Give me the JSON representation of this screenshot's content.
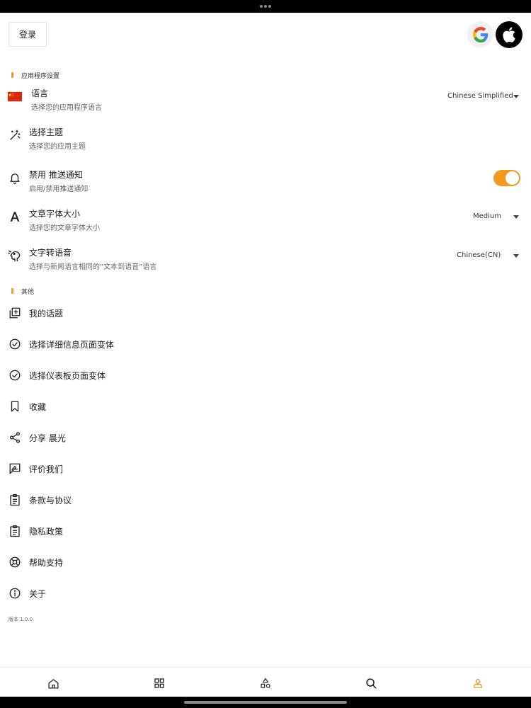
{
  "header": {
    "login_label": "登录"
  },
  "sections": {
    "app_settings": "应用程序设置",
    "other": "其他"
  },
  "settings": {
    "language": {
      "title": "语言",
      "subtitle": "选择您的应用程序语言",
      "value": "Chinese Simplified",
      "icon": "china-flag-icon"
    },
    "theme": {
      "title": "选择主题",
      "subtitle": "选择您的应用主题",
      "icon": "magic-wand-icon"
    },
    "push": {
      "title": "禁用 推送通知",
      "subtitle": "启用/禁用推送通知",
      "enabled": true,
      "icon": "bell-icon"
    },
    "font_size": {
      "title": "文章字体大小",
      "subtitle": "选择您的文章字体大小",
      "value": "Medium",
      "icon": "font-icon"
    },
    "tts": {
      "title": "文字转语音",
      "subtitle": "选择与新闻语言相同的“文本到语音”语言",
      "value": "Chinese(CN)",
      "icon": "speaking-head-icon"
    }
  },
  "menu": {
    "my_topics": "我的话题",
    "detail_variant": "选择详细信息页面变体",
    "dashboard_variant": "选择仪表板页面变体",
    "bookmarks": "收藏",
    "share": "分享 晨光",
    "rate": "评价我们",
    "terms": "条款与协议",
    "privacy": "隐私政策",
    "help": "帮助支持",
    "about": "关于"
  },
  "version": "版本 1.0.0",
  "colors": {
    "accent": "#f39a1e",
    "text": "#222222",
    "subtext": "#666666"
  },
  "bottom_nav": [
    "home-icon",
    "grid-icon",
    "categories-icon",
    "search-icon",
    "profile-icon"
  ],
  "active_tab": "profile-icon"
}
